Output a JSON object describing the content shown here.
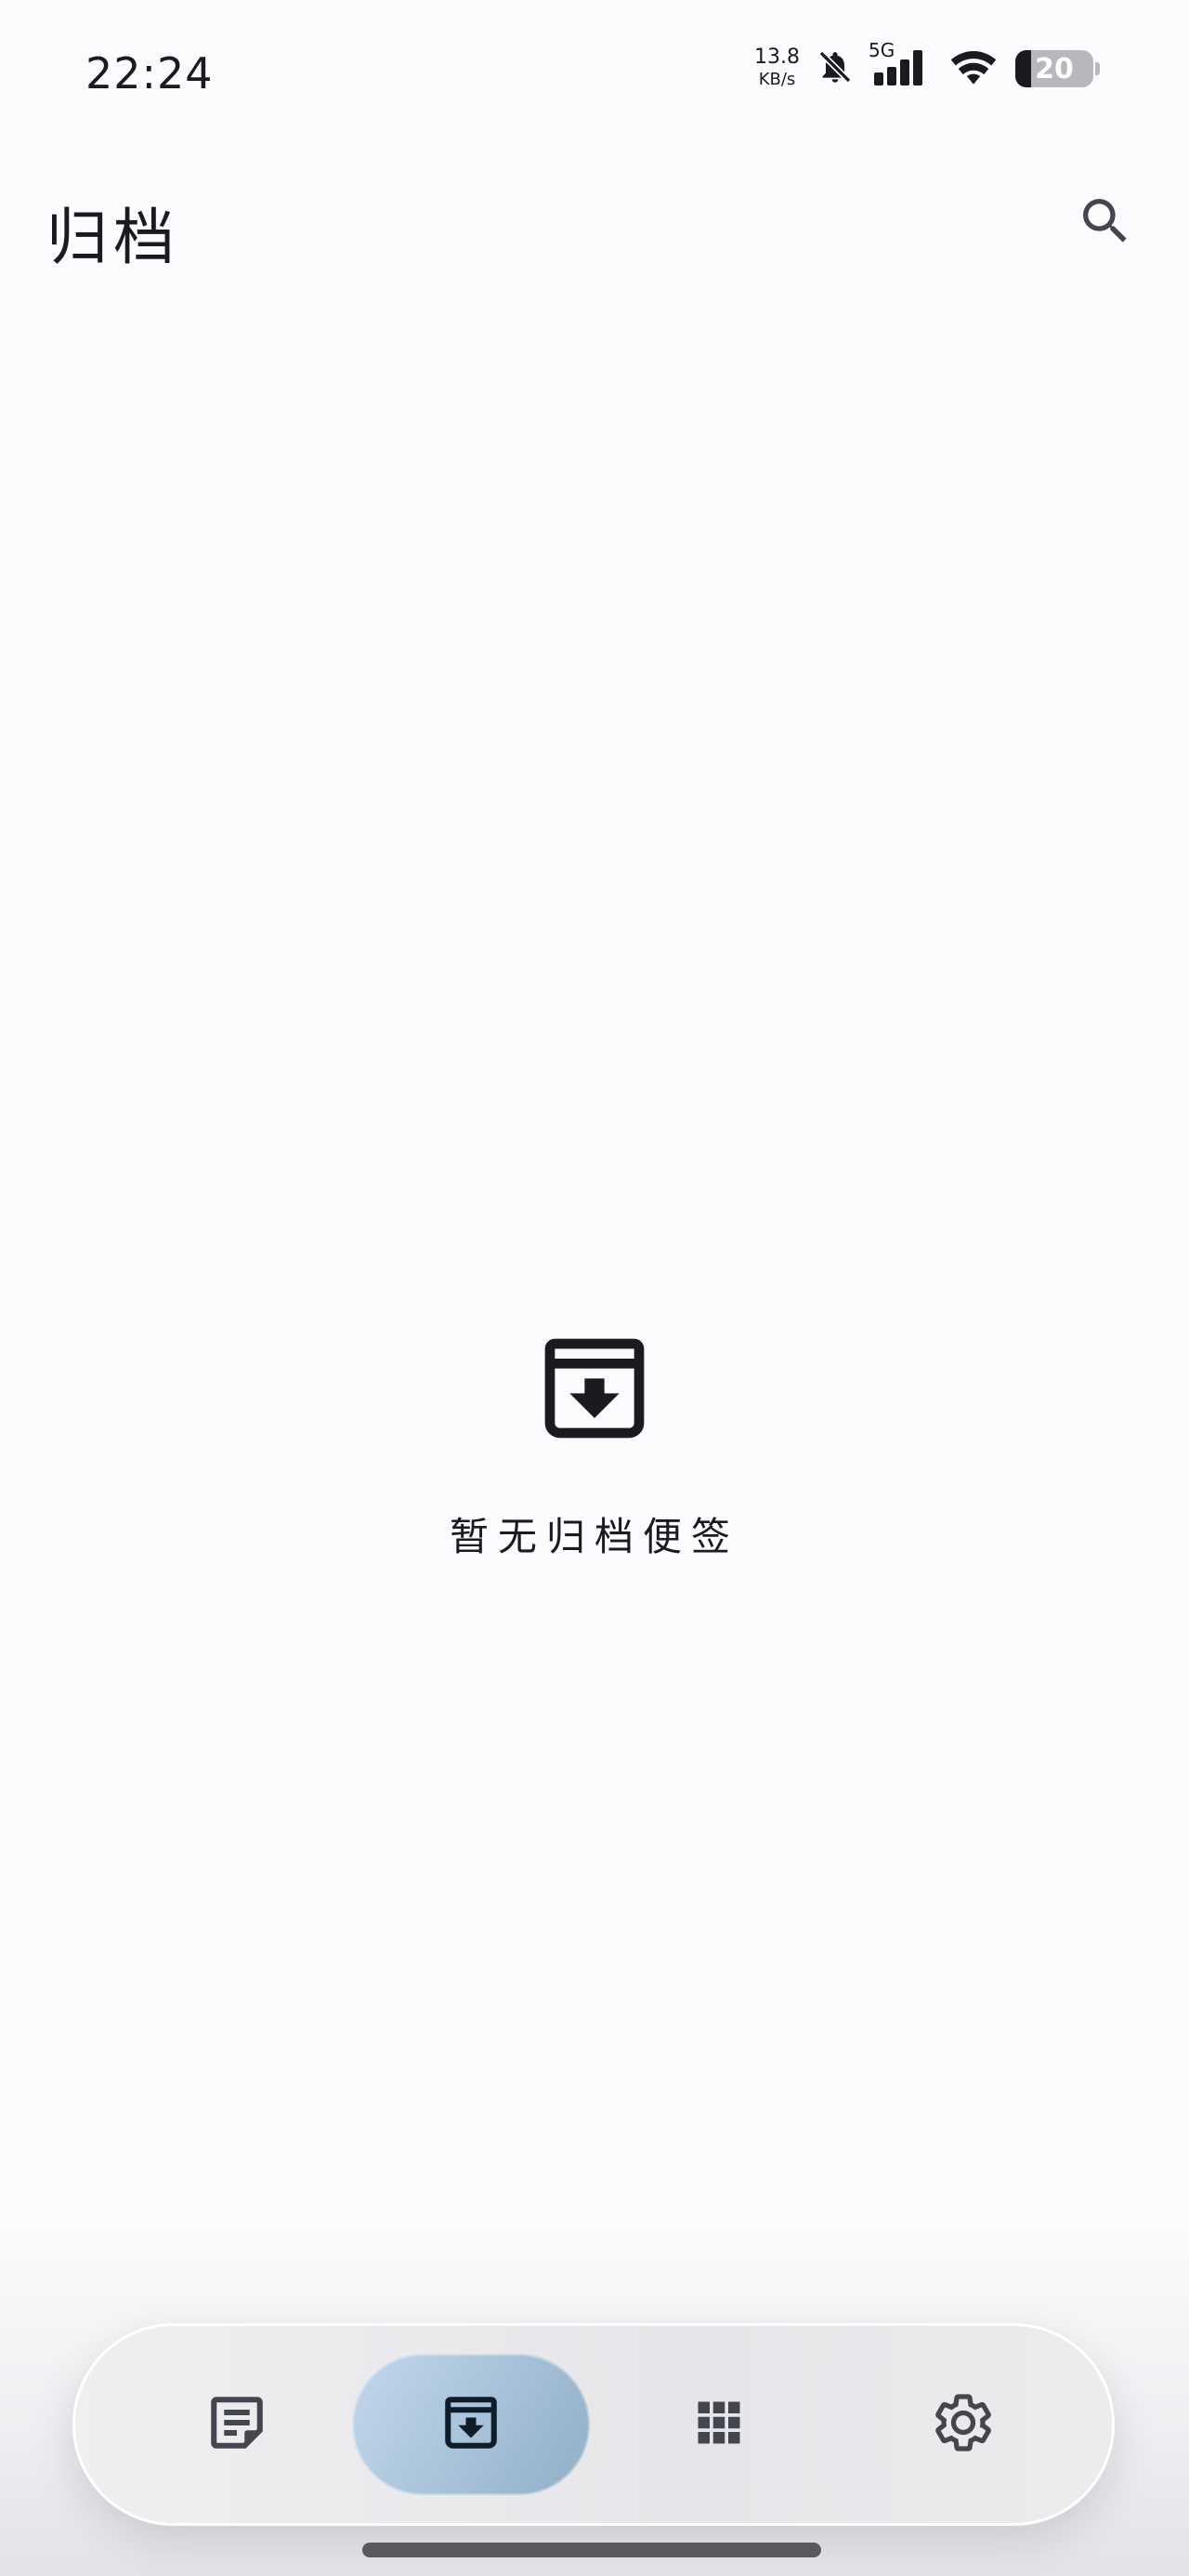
{
  "status_bar": {
    "time": "22:24",
    "net_speed_value": "13.8",
    "net_speed_unit": "KB/s",
    "network_type": "5G",
    "battery_percent": 20,
    "battery_label": "20",
    "icons": [
      "bell-off-icon",
      "cellular-signal-icon",
      "wifi-icon",
      "battery-icon"
    ]
  },
  "app_bar": {
    "title": "归档",
    "search_icon": "search-icon"
  },
  "empty_state": {
    "icon": "archive-icon",
    "message": "暂无归档便签"
  },
  "bottom_nav": {
    "items": [
      {
        "id": "notes",
        "icon": "note-icon",
        "active": false
      },
      {
        "id": "archive",
        "icon": "archive-icon",
        "active": true
      },
      {
        "id": "apps",
        "icon": "grid-icon",
        "active": false
      },
      {
        "id": "settings",
        "icon": "gear-icon",
        "active": false
      }
    ]
  },
  "colors": {
    "background": "#fcfcfe",
    "text": "#1b1b1f",
    "icon": "#44464f",
    "active_pill": "#a9c3da"
  }
}
